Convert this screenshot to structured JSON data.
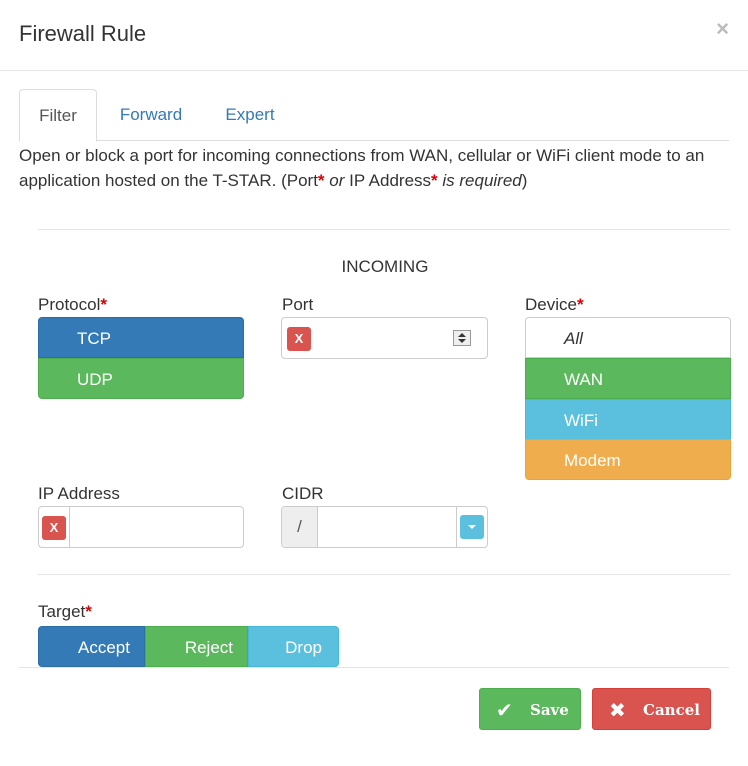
{
  "dialog": {
    "title": "Firewall Rule",
    "close_glyph": "×"
  },
  "tabs": [
    {
      "label": "Filter",
      "active": true
    },
    {
      "label": "Forward",
      "active": false
    },
    {
      "label": "Expert",
      "active": false
    }
  ],
  "description": {
    "part1": "Open or block a port for incoming connections from WAN, cellular or WiFi client mode to an application hosted on the T-STAR. (Port",
    "star1": "*",
    "or": " or",
    "part2": " IP Address",
    "star2": "*",
    "required": " is required",
    "close": ")"
  },
  "section": {
    "title": "INCOMING"
  },
  "protocol": {
    "label": "Protocol",
    "required": "*",
    "options": [
      "TCP",
      "UDP"
    ]
  },
  "port": {
    "label": "Port",
    "clear": "X",
    "value": ""
  },
  "device": {
    "label": "Device",
    "required": "*",
    "options": [
      "All",
      "WAN",
      "WiFi",
      "Modem"
    ]
  },
  "ip_address": {
    "label": "IP Address",
    "clear": "X",
    "value": ""
  },
  "cidr": {
    "label": "CIDR",
    "prefix": "/",
    "value": ""
  },
  "target": {
    "label": "Target",
    "required": "*",
    "options": [
      "Accept",
      "Reject",
      "Drop"
    ]
  },
  "footer": {
    "save": "Save",
    "cancel": "Cancel",
    "save_icon": "✔",
    "cancel_icon": "✖"
  },
  "colors": {
    "primary": "#337ab7",
    "success": "#5cb85c",
    "info": "#5bc0de",
    "warning": "#f0ad4e",
    "danger": "#d9534f"
  }
}
